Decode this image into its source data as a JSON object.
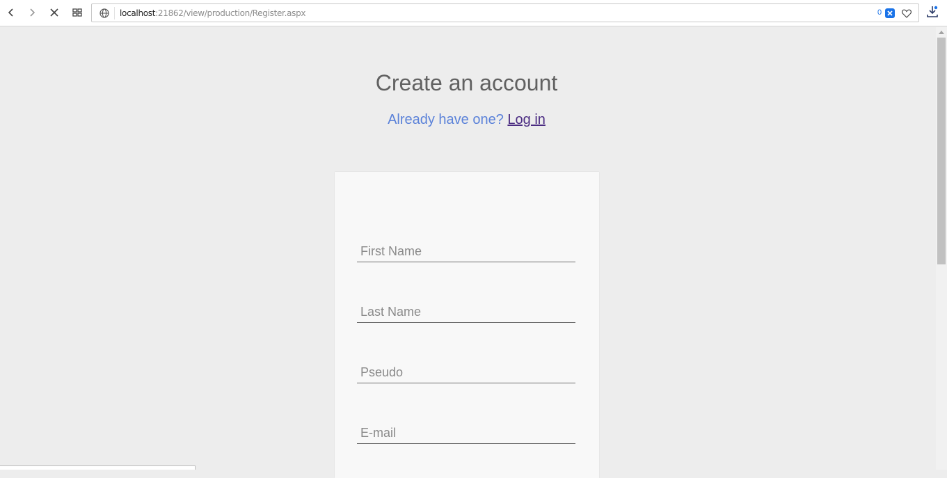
{
  "browser": {
    "url_host": "localhost",
    "url_rest": ":21862/view/production/Register.aspx",
    "blocked_count": "0",
    "accent_color": "#1a73e8"
  },
  "page": {
    "title": "Create an account",
    "subtitle_text": "Already have one?",
    "login_link": "Log in",
    "subtitle_color": "#5b82d9",
    "link_color": "#4b2c82"
  },
  "form": {
    "first_name_placeholder": "First Name",
    "last_name_placeholder": "Last Name",
    "pseudo_placeholder": "Pseudo",
    "email_placeholder": "E-mail"
  }
}
